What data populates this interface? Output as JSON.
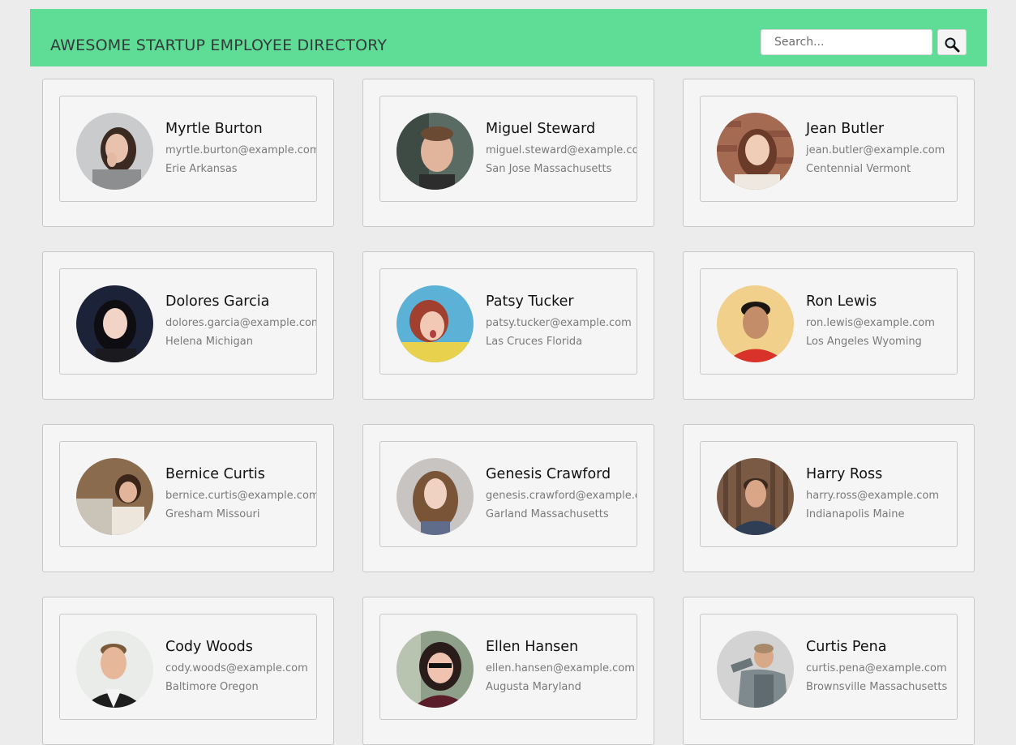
{
  "header": {
    "title": "AWESOME STARTUP EMPLOYEE DIRECTORY",
    "search_placeholder": "Search...",
    "search_button_icon": "magnifier-icon",
    "background_color": "#5fdc96"
  },
  "employees": [
    {
      "name": "Myrtle Burton",
      "email": "myrtle.burton@example.com",
      "location": "Erie Arkansas"
    },
    {
      "name": "Miguel Steward",
      "email": "miguel.steward@example.com",
      "location": "San Jose Massachusetts"
    },
    {
      "name": "Jean Butler",
      "email": "jean.butler@example.com",
      "location": "Centennial Vermont"
    },
    {
      "name": "Dolores Garcia",
      "email": "dolores.garcia@example.com",
      "location": "Helena Michigan"
    },
    {
      "name": "Patsy Tucker",
      "email": "patsy.tucker@example.com",
      "location": "Las Cruces Florida"
    },
    {
      "name": "Ron Lewis",
      "email": "ron.lewis@example.com",
      "location": "Los Angeles Wyoming"
    },
    {
      "name": "Bernice Curtis",
      "email": "bernice.curtis@example.com",
      "location": "Gresham Missouri"
    },
    {
      "name": "Genesis Crawford",
      "email": "genesis.crawford@example.com",
      "location": "Garland Massachusetts"
    },
    {
      "name": "Harry Ross",
      "email": "harry.ross@example.com",
      "location": "Indianapolis Maine"
    },
    {
      "name": "Cody Woods",
      "email": "cody.woods@example.com",
      "location": "Baltimore Oregon"
    },
    {
      "name": "Ellen Hansen",
      "email": "ellen.hansen@example.com",
      "location": "Augusta Maryland"
    },
    {
      "name": "Curtis Pena",
      "email": "curtis.pena@example.com",
      "location": "Brownsville Massachusetts"
    }
  ]
}
